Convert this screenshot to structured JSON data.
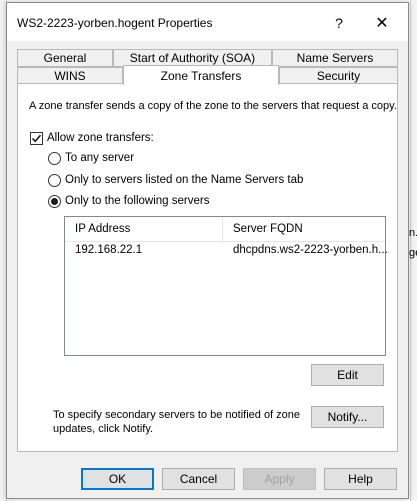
{
  "window": {
    "title": "WS2-2223-yorben.hogent Properties",
    "help_glyph": "?",
    "close_glyph": "✕"
  },
  "tabs": {
    "row1": [
      "General",
      "Start of Authority (SOA)",
      "Name Servers"
    ],
    "row2": [
      "WINS",
      "Zone Transfers",
      "Security"
    ],
    "active": "Zone Transfers"
  },
  "zone_transfers": {
    "description": "A zone transfer sends a copy of the zone to the servers that request a copy.",
    "allow_label": "Allow zone transfers:",
    "allow_checked": true,
    "options": [
      {
        "label": "To any server",
        "selected": false
      },
      {
        "label": "Only to servers listed on the Name Servers tab",
        "selected": false
      },
      {
        "label": "Only to the following servers",
        "selected": true
      }
    ],
    "server_list": {
      "columns": [
        "IP Address",
        "Server FQDN"
      ],
      "rows": [
        {
          "ip": "192.168.22.1",
          "fqdn": "dhcpdns.ws2-2223-yorben.h..."
        }
      ]
    },
    "edit_label": "Edit",
    "notify_text_line1": "To specify secondary servers to be notified of zone",
    "notify_text_line2": "updates, click Notify.",
    "notify_label": "Notify..."
  },
  "footer": {
    "ok": "OK",
    "cancel": "Cancel",
    "apply": "Apply",
    "help": "Help"
  },
  "background_fragments": {
    "right_1": "n..",
    "right_2": "ge"
  },
  "colors": {
    "primary_button_border": "#0078d7",
    "dialog_bg": "#f0f0f0"
  }
}
